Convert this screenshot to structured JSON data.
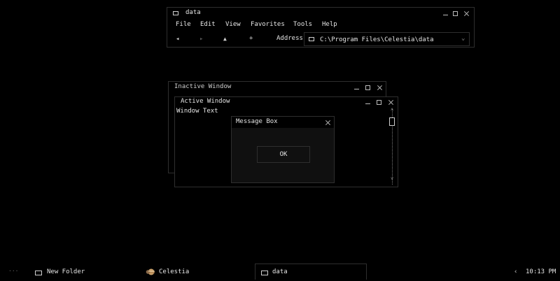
{
  "explorer": {
    "title": "data",
    "menu": [
      "File",
      "Edit",
      "View",
      "Favorites",
      "Tools",
      "Help"
    ],
    "toolbar": {
      "back": "◂",
      "forward": "▸",
      "up": "▲",
      "new": "+",
      "address_label": "Address",
      "address_value": "C:\\Program Files\\Celestia\\data",
      "dropdown": "⌄"
    }
  },
  "inactive_window": {
    "title": "Inactive Window"
  },
  "active_window": {
    "title": "Active Window",
    "text": "Window Text"
  },
  "message_box": {
    "title": "Message Box",
    "ok_label": "OK"
  },
  "taskbar": {
    "start_dots": "...",
    "items": [
      {
        "label": "New Folder",
        "icon": "folder-icon"
      },
      {
        "label": "Celestia",
        "icon": "celestia-icon"
      },
      {
        "label": "data",
        "icon": "window-icon",
        "active": true
      }
    ],
    "tray_arrow": "‹",
    "clock": "10:13 PM"
  },
  "colors": {
    "background": "#000000",
    "border": "#2e2e2e",
    "text": "#e6e6e6",
    "dialog": "#101010"
  }
}
